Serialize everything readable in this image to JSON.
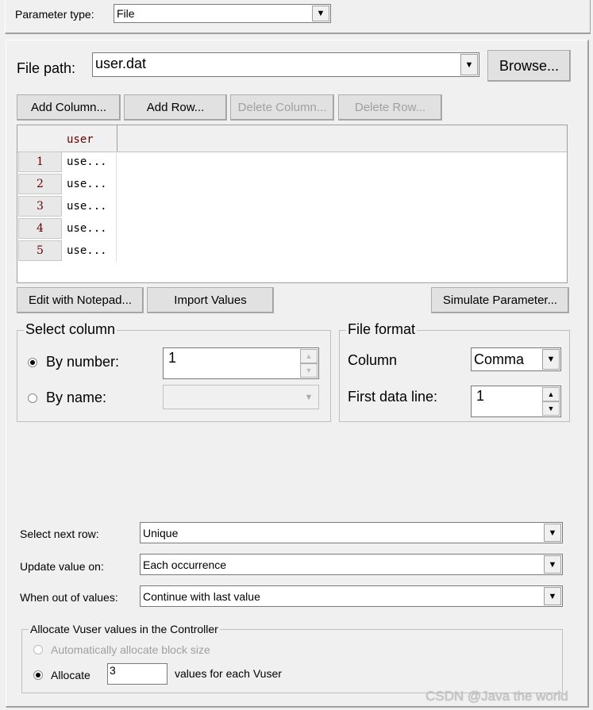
{
  "parameter_type": {
    "label": "Parameter type:",
    "value": "File"
  },
  "file_path": {
    "label": "File path:",
    "value": "user.dat",
    "browse": "Browse..."
  },
  "table_buttons": {
    "add_column": "Add Column...",
    "add_row": "Add Row...",
    "delete_column": "Delete Column...",
    "delete_row": "Delete Row..."
  },
  "grid": {
    "columns": [
      "user"
    ],
    "rows": [
      {
        "num": "1",
        "value": "use..."
      },
      {
        "num": "2",
        "value": "use..."
      },
      {
        "num": "3",
        "value": "use..."
      },
      {
        "num": "4",
        "value": "use..."
      },
      {
        "num": "5",
        "value": "use..."
      }
    ]
  },
  "bottom_buttons": {
    "edit": "Edit with Notepad...",
    "import": "Import Values",
    "simulate": "Simulate Parameter..."
  },
  "select_column": {
    "title": "Select column",
    "by_number": "By number:",
    "by_number_value": "1",
    "by_name": "By name:",
    "selected": "by_number"
  },
  "file_format": {
    "title": "File format",
    "column_label": "Column",
    "column_value": "Comma",
    "first_line_label": "First data line:",
    "first_line_value": "1"
  },
  "options": {
    "select_next_row_label": "Select next row:",
    "select_next_row": "Unique",
    "update_label": "Update value on:",
    "update_value": "Each occurrence",
    "out_label": "When out of values:",
    "out_value": "Continue with last value"
  },
  "allocate": {
    "title": "Allocate Vuser values in the Controller",
    "auto": "Automatically allocate block size",
    "allocate": "Allocate",
    "value": "3",
    "suffix": "values for each Vuser"
  },
  "watermark": "CSDN @Java the world"
}
